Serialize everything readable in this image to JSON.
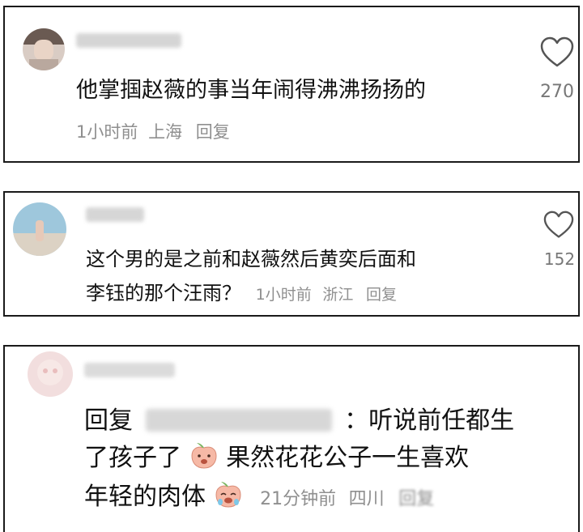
{
  "comments": [
    {
      "text": "他掌掴赵薇的事当年闹得沸沸扬扬的",
      "time": "1小时前",
      "location": "上海",
      "reply_label": "回复",
      "likes": "270"
    },
    {
      "text_line1": "这个男的是之前和赵薇然后黄奕后面和",
      "text_line2": "李钰的那个汪雨？",
      "time": "1小时前",
      "location": "浙江",
      "reply_label": "回复",
      "likes": "152"
    },
    {
      "reply_prefix": "回复",
      "colon_text": "：听说前任都生",
      "line2_a": "了孩子了",
      "line2_b": "果然花花公子一生喜欢",
      "line3": "年轻的肉体",
      "time": "21分钟前",
      "location": "四川",
      "reply_label": "回复"
    }
  ],
  "colors": {
    "border": "#1a1a1a",
    "meta": "#8f8f8f",
    "like_count": "#777777"
  },
  "icons": {
    "like": "heart-outline-icon",
    "emoji": "peach-face-emoji"
  }
}
